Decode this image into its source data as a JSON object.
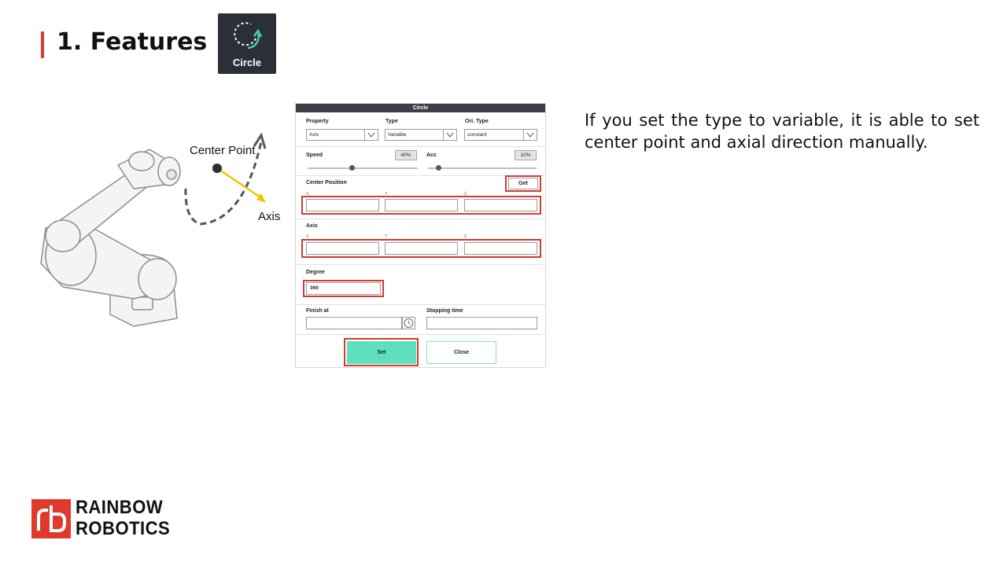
{
  "slide": {
    "title": "1. Features",
    "badge_label": "Circle",
    "description": "If you set the type to variable, it is able to set center point and axial direction manually."
  },
  "illustration": {
    "center_point_label": "Center Point",
    "axis_label": "Axis"
  },
  "dialog": {
    "title": "Circle",
    "property": {
      "label": "Property",
      "value": "Axis"
    },
    "type": {
      "label": "Type",
      "value": "Variable"
    },
    "ori_type": {
      "label": "Ori. Type",
      "value": "constant"
    },
    "speed": {
      "label": "Speed",
      "value": "40%",
      "level": 0.4
    },
    "acc": {
      "label": "Acc",
      "value": "10%",
      "level": 0.1
    },
    "center_position": {
      "label": "Center Position",
      "get_label": "Get",
      "x": "X",
      "y": "Y",
      "z": "Z"
    },
    "axis": {
      "label": "Axis",
      "x": "X",
      "y": "Y",
      "z": "Z"
    },
    "degree": {
      "label": "Degree",
      "value": "360"
    },
    "finish_at": {
      "label": "Finish at"
    },
    "stopping_time": {
      "label": "Stopping time"
    },
    "set_label": "Set",
    "close_label": "Close"
  },
  "colors": {
    "accent_red": "#e03a2e",
    "highlight_red": "#d33a32",
    "set_button": "#5fe0bd",
    "close_border": "#7fe3c8",
    "header_dark": "#3c3f46",
    "axis_arrow": "#f2c200"
  },
  "logo": {
    "line1": "RAINBOW",
    "line2": "ROBOTICS"
  }
}
